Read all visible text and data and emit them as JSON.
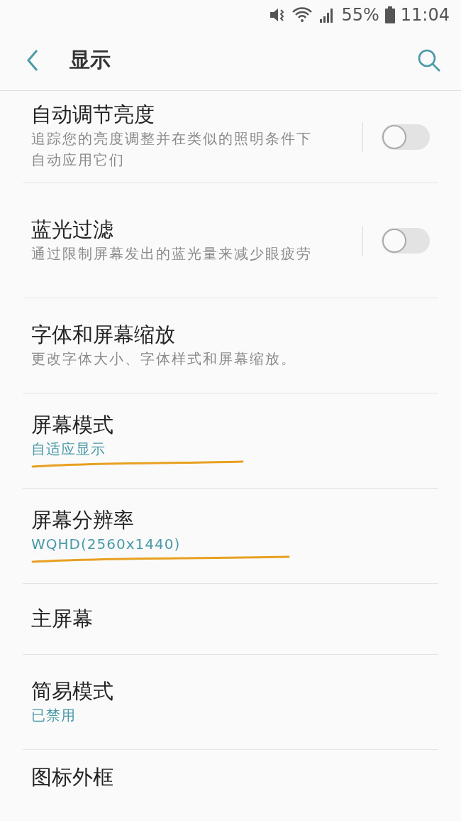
{
  "status_bar": {
    "battery": "55%",
    "time": "11:04"
  },
  "header": {
    "title": "显示"
  },
  "settings": [
    {
      "kind": "toggle",
      "title": "自动调节亮度",
      "subtitle": "追踪您的亮度调整并在类似的照明条件下自动应用它们",
      "on": false
    },
    {
      "kind": "toggle",
      "title": "蓝光过滤",
      "subtitle": "通过限制屏幕发出的蓝光量来减少眼疲劳",
      "on": false
    },
    {
      "kind": "link",
      "title": "字体和屏幕缩放",
      "subtitle": "更改字体大小、字体样式和屏幕缩放。"
    },
    {
      "kind": "value",
      "title": "屏幕模式",
      "value": "自适应显示",
      "underlined": true
    },
    {
      "kind": "value",
      "title": "屏幕分辨率",
      "value": "WQHD(2560x1440)",
      "underlined": true
    },
    {
      "kind": "link",
      "title": "主屏幕"
    },
    {
      "kind": "value",
      "title": "简易模式",
      "value": "已禁用"
    },
    {
      "kind": "link",
      "title": "图标外框"
    }
  ]
}
